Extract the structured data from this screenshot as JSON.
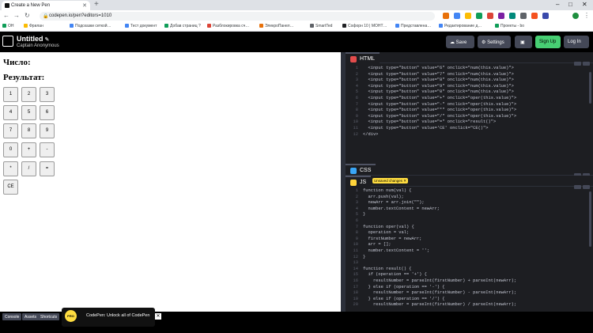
{
  "browser": {
    "tab_title": "Create a New Pen",
    "url": "codepen.io/pen?editors=1010",
    "bookmarks": [
      "OH",
      "Фрилан",
      "Подсказки сеткой…",
      "Тест документ",
      "Добав страниц ?",
      "Разблокировка сч…",
      "ЭлекроПанел…",
      "SmartTed",
      "Софорн 10 | МОНТ…",
      "Представлена…",
      "Редактирование д…",
      "Проекты - bo"
    ],
    "colors": {
      "tab_bg": "#dee1e6"
    }
  },
  "header": {
    "title": "Untitled",
    "author": "Captain Anonymous",
    "save_label": "Save",
    "settings_label": "Settings",
    "signup_label": "Sign Up",
    "login_label": "Log In"
  },
  "preview": {
    "number_label": "Число:",
    "result_label": "Результат:",
    "buttons": [
      "1",
      "2",
      "3",
      "4",
      "5",
      "6",
      "7",
      "8",
      "9",
      "0",
      "+",
      "-",
      "*",
      "/",
      "=",
      "CE"
    ]
  },
  "html_editor": {
    "label": "HTML",
    "lines": [
      {
        "n": "1",
        "code": "  <input type=\"button\" value=\"6\" onclick=\"num(this.value)\">"
      },
      {
        "n": "2",
        "code": "  <input type=\"button\" value=\"7\" onclick=\"num(this.value)\">"
      },
      {
        "n": "3",
        "code": "  <input type=\"button\" value=\"8\" onclick=\"num(this.value)\">"
      },
      {
        "n": "4",
        "code": "  <input type=\"button\" value=\"9\" onclick=\"num(this.value)\">"
      },
      {
        "n": "5",
        "code": "  <input type=\"button\" value=\"0\" onclick=\"num(this.value)\">"
      },
      {
        "n": "6",
        "code": "  <input type=\"button\" value=\"+\" onclick=\"oper(this.value)\">"
      },
      {
        "n": "7",
        "code": "  <input type=\"button\" value=\"-\" onclick=\"oper(this.value)\">"
      },
      {
        "n": "8",
        "code": "  <input type=\"button\" value=\"*\" onclick=\"oper(this.value)\">"
      },
      {
        "n": "9",
        "code": "  <input type=\"button\" value=\"/\" onclick=\"oper(this.value)\">"
      },
      {
        "n": "10",
        "code": "  <input type=\"button\" value=\"=\" onclick=\"result()\">"
      },
      {
        "n": "11",
        "code": "  <input type=\"button\" value='CE' onclick=\"CE()\">"
      },
      {
        "n": "12",
        "code": "</div>"
      }
    ]
  },
  "css_editor": {
    "label": "CSS"
  },
  "js_editor": {
    "label": "JS",
    "unsaved_label": "Unsaved changes",
    "lines": [
      {
        "n": "1",
        "code": "function num(val) {"
      },
      {
        "n": "2",
        "code": "  arr.push(val);"
      },
      {
        "n": "3",
        "code": "  newArr = arr.join(\"\");"
      },
      {
        "n": "4",
        "code": "  number.textContent = newArr;"
      },
      {
        "n": "5",
        "code": "}"
      },
      {
        "n": "6",
        "code": ""
      },
      {
        "n": "7",
        "code": "function oper(val) {"
      },
      {
        "n": "8",
        "code": "  operation = val;"
      },
      {
        "n": "9",
        "code": "  firstNumber = newArr;"
      },
      {
        "n": "10",
        "code": "  arr = [];"
      },
      {
        "n": "11",
        "code": "  number.textContent = '';"
      },
      {
        "n": "12",
        "code": "}"
      },
      {
        "n": "13",
        "code": ""
      },
      {
        "n": "14",
        "code": "function result() {"
      },
      {
        "n": "15",
        "code": "  if (operation == '+') {"
      },
      {
        "n": "16",
        "code": "    resultNumber = parseInt(firstNumber) + parseInt(newArr);"
      },
      {
        "n": "17",
        "code": "  } else if (operation == '-') {"
      },
      {
        "n": "18",
        "code": "    resultNumber = parseInt(firstNumber) - parseInt(newArr);"
      },
      {
        "n": "19",
        "code": "  } else if (operation == '/') {"
      },
      {
        "n": "20",
        "code": "    resultNumber = parseInt(firstNumber) / parseInt(newArr);"
      }
    ]
  },
  "footer": {
    "console_label": "Console",
    "assets_label": "Assets",
    "shortcuts_label": "Shortcuts",
    "promo_badge": "PRO",
    "promo_text": "CodePen: Unlock all of CodePen"
  }
}
